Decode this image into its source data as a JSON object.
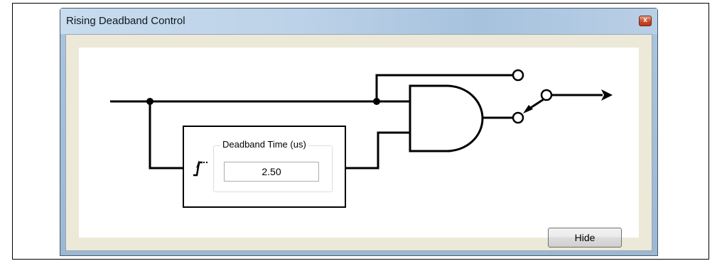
{
  "window": {
    "title": "Rising Deadband Control",
    "close_glyph": "x",
    "close_icon": "close-icon"
  },
  "deadband": {
    "group_label": "Deadband Time (us)",
    "value": "2.50"
  },
  "buttons": {
    "hide_label": "Hide"
  },
  "diagram": {
    "edge_icon": "rising-edge-delay-icon",
    "gate_icon": "and-gate-icon",
    "switch_icon": "output-switch-icon",
    "output_arrow_icon": "arrow-right-icon"
  },
  "colors": {
    "titlebar": "#bcd2e8",
    "client_background": "#ece9d8",
    "close_button": "#c94a2a",
    "wire": "#000000"
  }
}
